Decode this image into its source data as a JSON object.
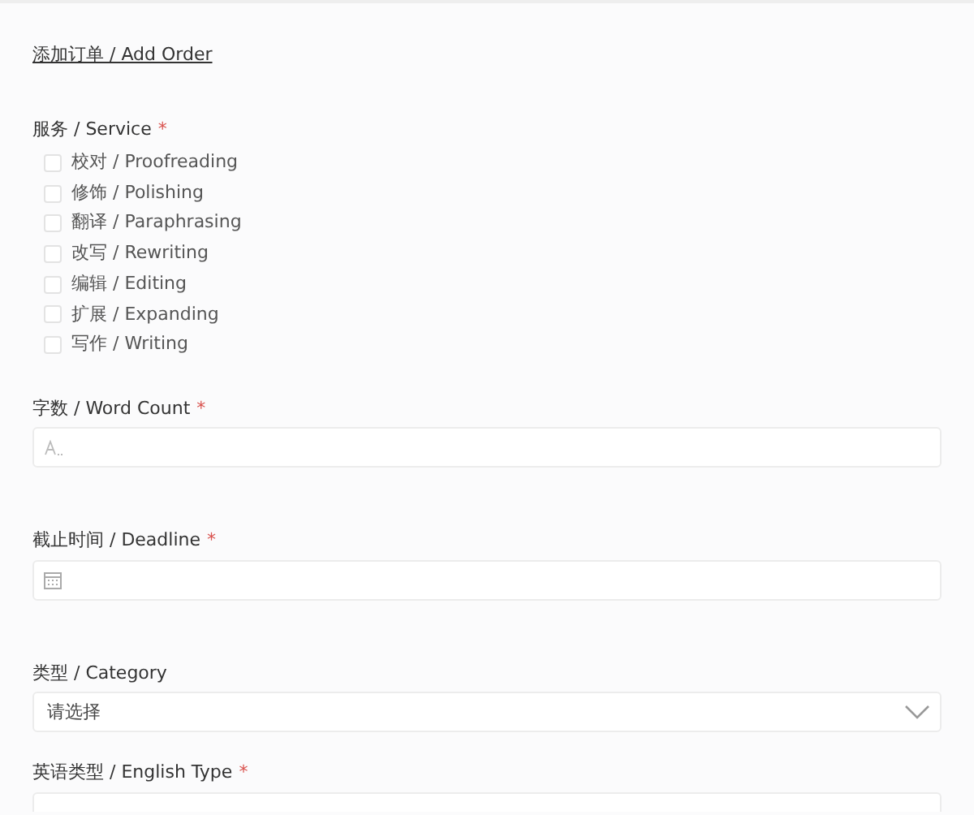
{
  "title": "添加订单 / Add Order",
  "fields": [
    {
      "kind": "checkboxes",
      "label": "服务 / Service",
      "required_mark": "*",
      "options": [
        {
          "label": "校对 / Proofreading",
          "checked": false
        },
        {
          "label": "修饰 / Polishing",
          "checked": false
        },
        {
          "label": "翻译 / Paraphrasing",
          "checked": false
        },
        {
          "label": "改写 / Rewriting",
          "checked": false
        },
        {
          "label": "编辑 / Editing",
          "checked": false
        },
        {
          "label": "扩展 / Expanding",
          "checked": false
        },
        {
          "label": "写作 / Writing",
          "checked": false
        }
      ]
    },
    {
      "kind": "text",
      "label": "字数 / Word Count",
      "required_mark": "*"
    },
    {
      "kind": "date",
      "label": "截止时间 / Deadline",
      "required_mark": "*"
    },
    {
      "kind": "select",
      "label": "类型 / Category",
      "value": "请选择"
    },
    {
      "kind": "select",
      "label": "英语类型 / English Type",
      "required_mark": "*"
    }
  ]
}
